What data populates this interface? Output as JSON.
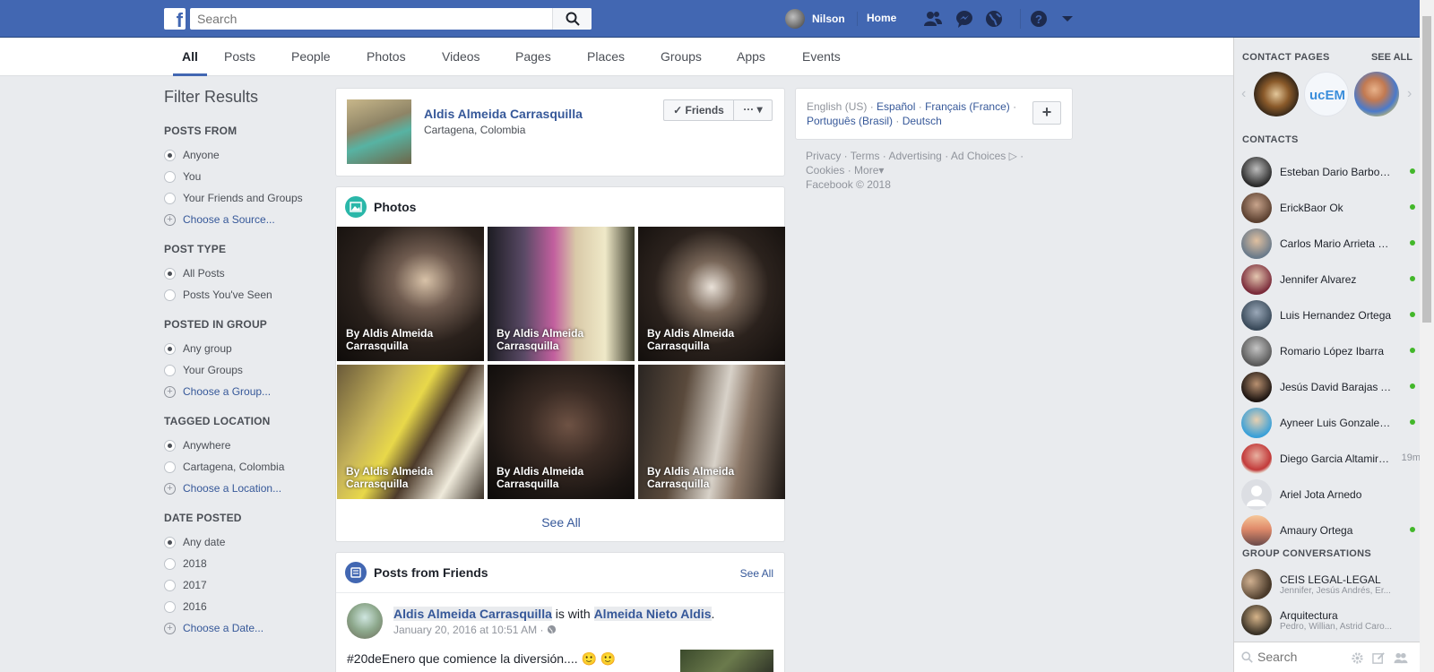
{
  "topbar": {
    "logo_letter": "f",
    "search_placeholder": "Search",
    "user_name": "Nilson",
    "home_label": "Home",
    "icons": [
      "friend-requests-icon",
      "messenger-icon",
      "notifications-globe-icon",
      "help-icon",
      "account-menu-icon"
    ]
  },
  "tabs": [
    {
      "label": "All",
      "active": true
    },
    {
      "label": "Posts"
    },
    {
      "label": "People"
    },
    {
      "label": "Photos"
    },
    {
      "label": "Videos"
    },
    {
      "label": "Pages"
    },
    {
      "label": "Places"
    },
    {
      "label": "Groups"
    },
    {
      "label": "Apps"
    },
    {
      "label": "Events"
    }
  ],
  "filters": {
    "title": "Filter Results",
    "posts_from": {
      "title": "POSTS FROM",
      "options": [
        "Anyone",
        "You",
        "Your Friends and Groups"
      ],
      "choose": "Choose a Source..."
    },
    "post_type": {
      "title": "POST TYPE",
      "options": [
        "All Posts",
        "Posts You've Seen"
      ]
    },
    "posted_in_group": {
      "title": "POSTED IN GROUP",
      "options": [
        "Any group",
        "Your Groups"
      ],
      "choose": "Choose a Group..."
    },
    "tagged_location": {
      "title": "TAGGED LOCATION",
      "options": [
        "Anywhere",
        "Cartagena, Colombia"
      ],
      "choose": "Choose a Location..."
    },
    "date_posted": {
      "title": "DATE POSTED",
      "options": [
        "Any date",
        "2018",
        "2017",
        "2016"
      ],
      "choose": "Choose a Date..."
    }
  },
  "person": {
    "name": "Aldis Almeida Carrasquilla",
    "location": "Cartagena, Colombia",
    "friends_button": "Friends",
    "more_button": "···"
  },
  "photos": {
    "title": "Photos",
    "captions": [
      "By Aldis Almeida Carrasquilla",
      "By Aldis Almeida Carrasquilla",
      "By Aldis Almeida Carrasquilla",
      "By Aldis Almeida Carrasquilla",
      "By Aldis Almeida Carrasquilla",
      "By Aldis Almeida Carrasquilla"
    ],
    "see_all": "See All"
  },
  "posts_from_friends": {
    "title": "Posts from Friends",
    "see_all": "See All",
    "post": {
      "author": "Aldis Almeida Carrasquilla",
      "with_text": "is with",
      "tagged": "Almeida Nieto Aldis",
      "time": "January 20, 2016 at 10:51 AM ·",
      "text": "#20deEnero que comience la diversión.... 🙂 🙂"
    }
  },
  "languages": {
    "current": "English (US) ·",
    "links": [
      "Español",
      "Français (France)",
      "Português (Brasil)",
      "Deutsch"
    ],
    "add": "+"
  },
  "footer": {
    "links": [
      "Privacy",
      "Terms",
      "Advertising",
      "Ad Choices",
      "Cookies",
      "More"
    ],
    "copyright": "Facebook © 2018"
  },
  "chat": {
    "contact_pages_title": "CONTACT PAGES",
    "see_all": "SEE ALL",
    "contacts_title": "CONTACTS",
    "contacts": [
      {
        "name": "Esteban Dario Barbosa Pat...",
        "online": true
      },
      {
        "name": "ErickBaor Ok",
        "online": true
      },
      {
        "name": "Carlos Mario Arrieta Mendoza",
        "online": true
      },
      {
        "name": "Jennifer Alvarez",
        "online": true
      },
      {
        "name": "Luis Hernandez Ortega",
        "online": true
      },
      {
        "name": "Romario López Ibarra",
        "online": true
      },
      {
        "name": "Jesús David Barajas Alvarez",
        "online": true
      },
      {
        "name": "Ayneer Luis Gonzalez Jimenez",
        "online": true
      },
      {
        "name": "Diego Garcia Altamiranda",
        "online": false,
        "ago": "19m"
      },
      {
        "name": "Ariel Jota Arnedo",
        "online": false
      },
      {
        "name": "Amaury Ortega",
        "online": true
      }
    ],
    "group_title": "GROUP CONVERSATIONS",
    "groups": [
      {
        "name": "CEIS LEGAL-LEGAL",
        "members": "Jennifer, Jesús Andrés, Er..."
      },
      {
        "name": "Arquitectura",
        "members": "Pedro, Willian, Astrid Caro..."
      }
    ],
    "search_placeholder": "Search"
  },
  "colors": {
    "brand": "#4267b2",
    "link": "#365899",
    "online": "#42b72a"
  }
}
